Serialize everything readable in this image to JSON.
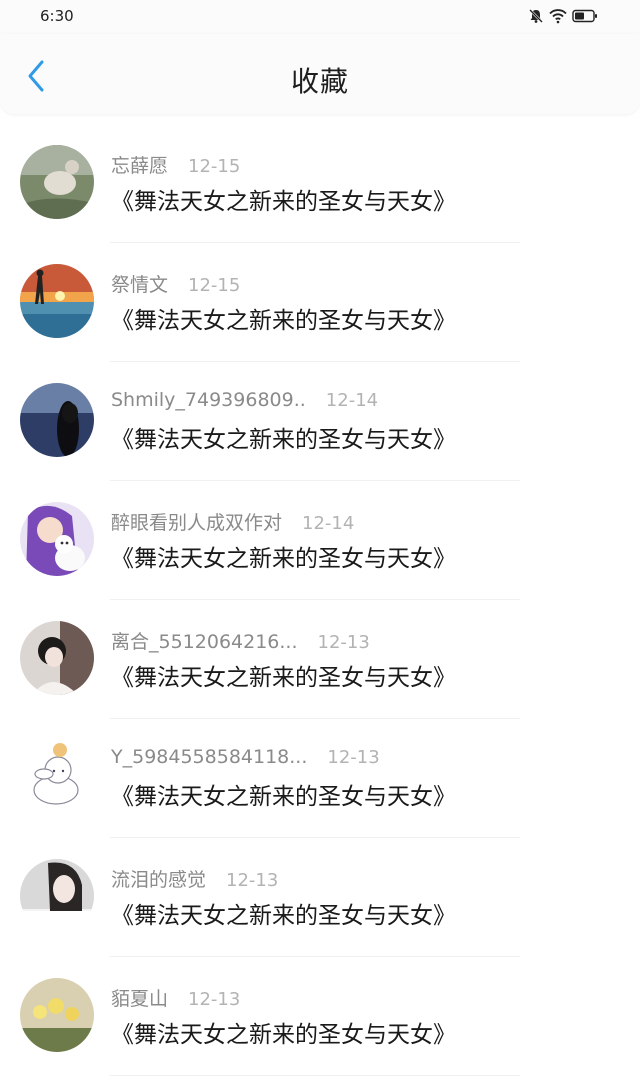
{
  "status": {
    "time": "6:30"
  },
  "header": {
    "title": "收藏"
  },
  "items": [
    {
      "name": "忘薛愿",
      "date": "12-15",
      "book": "《舞法天女之新来的圣女与天女》"
    },
    {
      "name": "祭情文",
      "date": "12-15",
      "book": "《舞法天女之新来的圣女与天女》"
    },
    {
      "name": "Shmily_749396809..",
      "date": "12-14",
      "book": "《舞法天女之新来的圣女与天女》"
    },
    {
      "name": "醉眼看别人成双作对",
      "date": "12-14",
      "book": "《舞法天女之新来的圣女与天女》"
    },
    {
      "name": "离合_5512064216...",
      "date": "12-13",
      "book": "《舞法天女之新来的圣女与天女》"
    },
    {
      "name": "Y_5984558584118...",
      "date": "12-13",
      "book": "《舞法天女之新来的圣女与天女》"
    },
    {
      "name": "流泪的感觉",
      "date": "12-13",
      "book": "《舞法天女之新来的圣女与天女》"
    },
    {
      "name": "貊夏山",
      "date": "12-13",
      "book": "《舞法天女之新来的圣女与天女》"
    }
  ],
  "colors": {
    "accent": "#2f9be8",
    "name": "#8a8a8a",
    "date": "#b3b3b3"
  }
}
